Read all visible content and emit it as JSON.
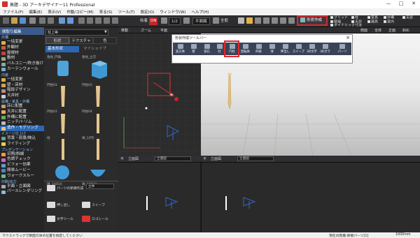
{
  "window": {
    "title": "無題 - 3D アーキデザイナー11 Professional",
    "controls": [
      "—",
      "□",
      "✕"
    ]
  },
  "menu": [
    "ファイル(F)",
    "編集(E)",
    "表示(V)",
    "作動/コピー(M)",
    "見る(S)",
    "ツール(T)",
    "設定(O)",
    "ウィンドウ(W)",
    "ヘルプ(H)"
  ],
  "toolbar": {
    "badge_label": "吸着",
    "badge_value": "ON",
    "scale_value": "1/2",
    "plan_label": "平面図",
    "view_label": "全般",
    "shape_button": "形状作成",
    "checks_col1": [
      "グリッド",
      "壁端",
      "ダイナミック寸法"
    ],
    "checks_col2": [
      "柱",
      "天井"
    ],
    "checks_col3": [
      "家具",
      "建具"
    ],
    "checks_col4": [
      "外構",
      "室内"
    ],
    "checks_col5": [
      "天窓"
    ]
  },
  "left_panel": {
    "header": "間取り編集",
    "sections": [
      {
        "title": "外構",
        "items": [
          "一括変更",
          "外観材",
          "屋根材",
          "敷材",
          "バルコニー/吹き抜け",
          "カーテンウォール"
        ]
      },
      {
        "title": "内装",
        "items": [
          "一括変更",
          "壁・床材",
          "階段デザイン",
          "天井材"
        ]
      },
      {
        "title": "設備・家具・外構",
        "items": [
          "床に配置",
          "天井に配置",
          "外構に配置",
          "ニッチ/トリム",
          "造作・モデリング"
        ]
      },
      {
        "title": "イメージ仕上げ",
        "items": [
          "背景・前景/映込",
          "ライティング"
        ]
      },
      {
        "title": "プレゼンテーション",
        "items": [
          "日照/斜線",
          "色調チェック",
          "ビフォー効果",
          "簡単ムービー",
          "ウォークスルー"
        ]
      },
      {
        "title": "印刷/出力",
        "items": [
          "平面・立面図",
          "パースレンダリング"
        ]
      }
    ],
    "selected": "造作・モデリング"
  },
  "middle_panel": {
    "dropdown": "柱上等",
    "tabs": [
      "形状",
      "テクスチャ",
      "色"
    ],
    "category": "基本形状",
    "category_alt": "マイシェイプ",
    "thumbs": [
      "角柱_円角",
      "角柱_立方",
      "円柱01",
      "円柱03",
      "円柱03",
      "円柱04",
      "柱",
      "球_1(円)",
      "球_1(010)",
      "球_1(011)"
    ],
    "parts_buttons": [
      "パーツの新規作成",
      "押し出し",
      "スイープ",
      "文字ツール",
      "ロゴシール"
    ],
    "parts_dropdown": "立体"
  },
  "strip": [
    "移動",
    "ズーム",
    "平面",
    "側面",
    "全体",
    "正面",
    "斜め"
  ],
  "palette": {
    "title": "形状作成ツールバー",
    "buttons": [
      "直方体",
      "壁",
      "穿孔",
      "柱",
      "円柱",
      "四角",
      "球",
      "回転体",
      "押出し",
      "スイープ",
      "3D文字",
      "3Dガラ",
      "パーツ"
    ],
    "highlight": "回転体",
    "extra": "新規作成"
  },
  "elevation": {
    "left_tabs": [
      "平",
      "立面図"
    ],
    "left_drop": "立面図",
    "right_tabs": [
      "平",
      "立面図"
    ],
    "right_drop": "立面図"
  },
  "status": {
    "left": "マウスドラッグで断面方体の位置を指定してください",
    "right1": "現在の階層:新規パーツ[1]",
    "right2": "1000mm"
  }
}
